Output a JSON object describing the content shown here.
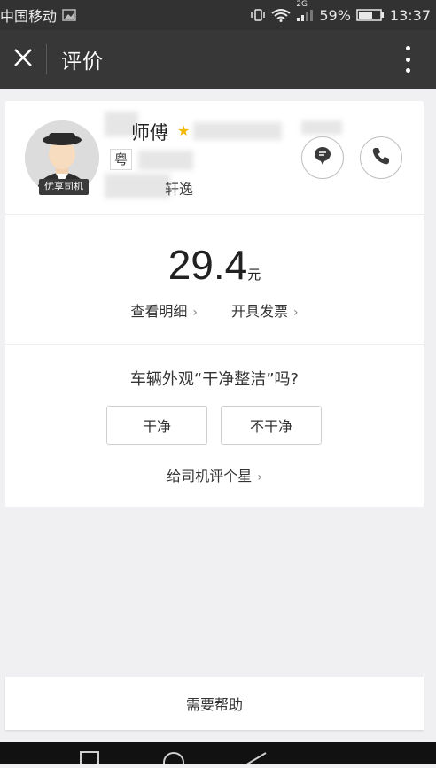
{
  "status_bar": {
    "carrier": "中国移动",
    "network": "2G",
    "battery": "59%",
    "time": "13:37"
  },
  "title_bar": {
    "title": "评价"
  },
  "driver": {
    "name_suffix": "师傅",
    "plate_prefix": "粤",
    "car_model_suffix": "轩逸",
    "badge": "优享司机"
  },
  "fare": {
    "amount": "29.4",
    "unit": "元",
    "detail_link": "查看明细",
    "invoice_link": "开具发票"
  },
  "cleanliness": {
    "question": "车辆外观“干净整洁”吗?",
    "option_clean": "干净",
    "option_dirty": "不干净",
    "rate_link": "给司机评个星"
  },
  "help": {
    "label": "需要帮助"
  },
  "colors": {
    "star": "#f5b800",
    "header": "#373737",
    "background": "#f0f0f2"
  }
}
